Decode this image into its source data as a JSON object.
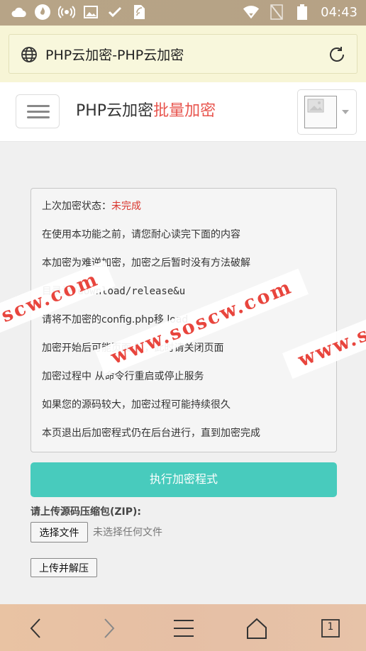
{
  "statusbar": {
    "time": "04:43"
  },
  "browser": {
    "page_title": "PHP云加密-PHP云加密"
  },
  "header": {
    "brand": "PHP云加密",
    "brand_highlight": "批量加密"
  },
  "info": {
    "status_label": "上次加密状态：",
    "status_value": "未完成",
    "lines": [
      "在使用本功能之前，请您耐心读完下面的内容",
      "本加密为难逆加密，加密之后暂时没有方法破解",
      "    目录为/download/release&u",
      "请将不加密的config.php移       load",
      "加密开始后可能页面        时，此时请关闭页面",
      "加密过程中       从命令行重启或停止服务",
      "如果您的源码较大，加密过程可能持续很久",
      "本页退出后加密程式仍在后台进行，直到加密完成"
    ]
  },
  "actions": {
    "run_label": "执行加密程式",
    "upload_label": "请上传源码压缩包(ZIP):",
    "choose_file_label": "选择文件",
    "no_file_label": "未选择任何文件",
    "upload_button_label": "上传并解压"
  },
  "watermark": {
    "w1": "scw.com",
    "w2": "www.soscw.com",
    "w3": "www.s"
  },
  "bottombar": {
    "tab_count": "1"
  }
}
